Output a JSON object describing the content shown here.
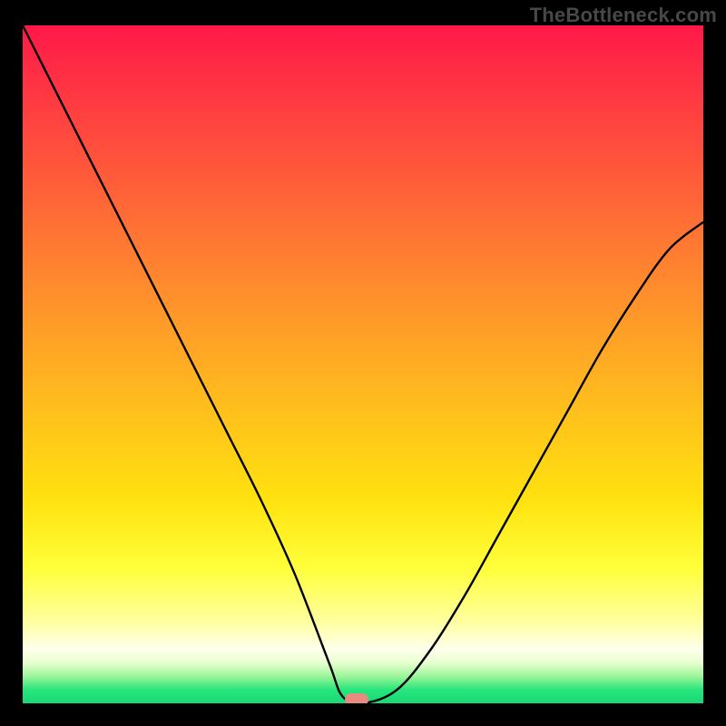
{
  "watermark": "TheBottleneck.com",
  "marker_color": "#e88a7f",
  "chart_data": {
    "type": "line",
    "title": "",
    "xlabel": "",
    "ylabel": "",
    "xlim": [
      0,
      100
    ],
    "ylim": [
      0,
      100
    ],
    "grid": false,
    "legend": false,
    "series": [
      {
        "name": "bottleneck-curve",
        "x": [
          0,
          5,
          10,
          15,
          20,
          25,
          30,
          35,
          40,
          45,
          47,
          50,
          55,
          60,
          65,
          70,
          75,
          80,
          85,
          90,
          95,
          100
        ],
        "y": [
          100,
          90,
          80,
          70,
          60,
          50,
          40,
          30,
          19,
          6,
          1,
          0,
          2,
          8,
          16,
          25,
          34,
          43,
          52,
          60,
          67,
          71
        ]
      }
    ],
    "marker": {
      "x": 49,
      "y": 0
    },
    "background_gradient": {
      "direction": "vertical",
      "stops": [
        {
          "pos": 0,
          "color": "#ff1848"
        },
        {
          "pos": 70,
          "color": "#ffe20f"
        },
        {
          "pos": 92,
          "color": "#ffffec"
        },
        {
          "pos": 100,
          "color": "#17d877"
        }
      ]
    }
  }
}
